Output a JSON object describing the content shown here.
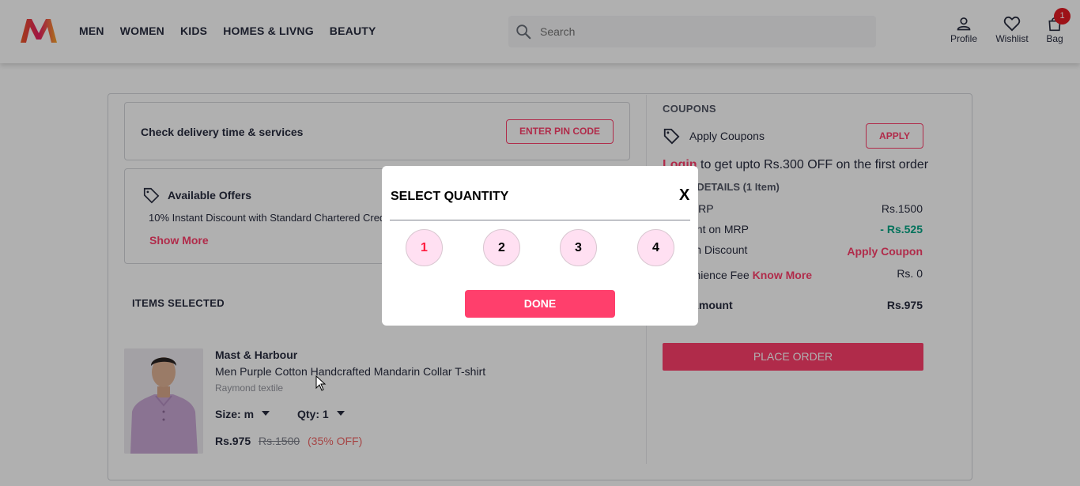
{
  "header": {
    "nav": [
      "MEN",
      "WOMEN",
      "KIDS",
      "HOMES & LIVNG",
      "BEAUTY"
    ],
    "search_placeholder": "Search",
    "profile_label": "Profile",
    "wishlist_label": "Wishlist",
    "bag_label": "Bag",
    "bag_count": "1"
  },
  "delivery": {
    "text": "Check delivery time & services",
    "button": "ENTER PIN CODE"
  },
  "offers": {
    "title": "Available Offers",
    "description": "10% Instant Discount with Standard Chartered Credit",
    "show_more": "Show More"
  },
  "items": {
    "heading": "ITEMS SELECTED",
    "product": {
      "brand": "Mast & Harbour",
      "name": "Men Purple Cotton Handcrafted Mandarin Collar T-shirt",
      "seller": "Raymond textile",
      "size_label": "Size: m",
      "qty_label": "Qty: 1",
      "price": "Rs.975",
      "mrp": "Rs.1500",
      "discount": "(35% OFF)"
    }
  },
  "summary": {
    "coupons_heading": "COUPONS",
    "apply_coupons": "Apply Coupons",
    "apply_button": "APPLY",
    "login_link": "Login",
    "login_text": " to get upto Rs.300 OFF on the first order",
    "price_details": "PRICE DETAILS (1 Item)",
    "rows": [
      {
        "label": "Total MRP",
        "value": "Rs.1500"
      },
      {
        "label": "Discount on MRP",
        "value": "- Rs.525"
      },
      {
        "label": "Coupon Discount",
        "value": "Apply Coupon"
      },
      {
        "label": "Convenience Fee",
        "link": "Know More",
        "value": "Rs. 0"
      },
      {
        "label": "Total Amount",
        "value": "Rs.975"
      }
    ],
    "place_order": "PLACE ORDER"
  },
  "modal": {
    "title": "SELECT QUANTITY",
    "close": "X",
    "options": [
      "1",
      "2",
      "3",
      "4"
    ],
    "selected": "1",
    "done": "DONE"
  },
  "colors": {
    "accent": "#ff3f6c",
    "green": "#03a685",
    "badge": "#e41b23"
  }
}
